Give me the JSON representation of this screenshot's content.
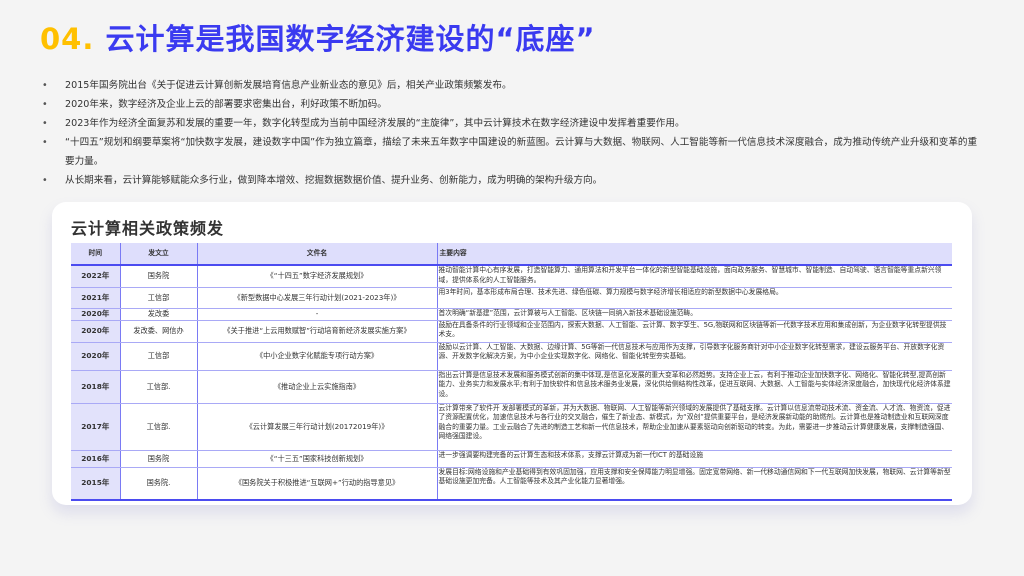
{
  "title": {
    "number": "04.",
    "text": "云计算是我国数字经济建设的“底座”"
  },
  "bullets": [
    "2015年国务院出台《关于促进云计算创新发展培育信息产业新业态的意见》后，相关产业政策频繁发布。",
    "2020年来，数字经济及企业上云的部署要求密集出台，利好政策不断加码。",
    "2023年作为经济全面复苏和发展的重要一年，数字化转型成为当前中国经济发展的“主旋律”，其中云计算技术在数字经济建设中发挥着重要作用。",
    "“十四五”规划和纲要草案将“加快数字发展，建设数字中国”作为独立篇章，描绘了未来五年数字中国建设的新蓝图。云计算与大数据、物联网、人工智能等新一代信息技术深度融合，成为推动传统产业升级和变革的重要力量。",
    "从长期来看，云计算能够赋能众多行业，做到降本增效、挖掘数据数据价值、提升业务、创新能力，成为明确的架构升级方向。"
  ],
  "table": {
    "title": "云计算相关政策频发",
    "headers": [
      "时间",
      "发文立",
      "文件名",
      "主要内容"
    ],
    "rows": [
      {
        "time": "2022年",
        "issuer": "国务院",
        "doc": "《“十四五”数字经济发展规划》",
        "content": "推动智能计算中心有序发展，打造智能算力、通用算法和开发平台一体化的新型智能基础设施，面向政务服务、智慧城市、智能制造、自动驾驶、语言智能等重点新兴领域，提供体系化的人工智能服务。"
      },
      {
        "time": "2021年",
        "issuer": "工信部",
        "doc": "《新型数据中心发展三年行动计划(2021-2023年)》",
        "content": "用3年时间，基本形成布局合理、技术先进、绿色低碳、算力规模与数字经济增长相适应的新型数据中心发展格局。"
      },
      {
        "time": "2020年",
        "issuer": "发改委",
        "doc": "-",
        "content": "首次明确“新基建”范围，云计算被与人工智能、区块链一同纳入新技术基础设施范畴。"
      },
      {
        "time": "2020年",
        "issuer": "发改委、网信办",
        "doc": "《关于推进“上云用数赋智”行动培育新经济发展实施方案》",
        "content": "鼓励在具备条件的行业领域和企业范围内，探索大数据、人工智能、云计算、数字孪生、5G,物联网和区块链等新一代数字技术应用和集成创新，为企业数字化转型提供技术支。"
      },
      {
        "time": "2020年",
        "issuer": "工信部",
        "doc": "《中小企业数字化赋能专项行动方案》",
        "content": "鼓励以云计算、人工智能、大数据、边缘计算、5G等新一代信息技术与应用作为支撑，引导数字化服务商针对中小企业数字化转型需求，建设云服务平台、开放数字化资源、开发数字化解决方案，为中小企业实现数字化、网络化、智能化转型夯实基础。"
      },
      {
        "time": "2018年",
        "issuer": "工信部.",
        "doc": "《推动企业上云实施指南》",
        "content": "指出云计算是信息技术发展和服务模式创新的集中体现,是信息化发展的重大变革和必然趋势。支持企业上云，有利于推动企业加快数字化、网络化、智能化转型,提高创新能力、业务实力和发展水平;有利于加快软件和信息技术服务业发展，深化供给侧结构性改革，促进互联网、大数据、人工智能与实体经济深度融合，加快现代化经济体系建设。"
      },
      {
        "time": "2017年",
        "issuer": "工信部.",
        "doc": "《云计算发展三年行动计划(20172019年)》",
        "content": "云计算带来了软件开 发部署模式的革新，并为大数据、物联网、人工智能等新兴领域的发展提供了基础支撑。云计算以信息流带动技术流、资金流、人才流、物资流，促进了资源配置优化，加速信息技术与各行业的交叉融合，催生了新业态、新模式，为“双创”提供重要平台，是经济发展新动能的助燃剂。云计算也是推动制造业和互联网深度融合的重要力量。工业云融合了先进的制造工艺和新一代信息技术，帮助企业加速从要素驱动向创新驱动的转变。为此，需要进一步推动云计算健康发展，支撑制造强国、网络强国建设。"
      },
      {
        "time": "2016年",
        "issuer": "国务院",
        "doc": "《“十三五”国家科技创新规划》",
        "content": "进一步强调要构建完备的云计算生态和技术体系，支撑云计算成为新一代ICT 的基础设施"
      },
      {
        "time": "2015年",
        "issuer": "国务院.",
        "doc": "《国务院关于积极推进“互联网+”行动的指导意见》",
        "content": "发展目标:网络设施和产业基础得到有效巩固加强，应用支撑和安全保障能力明显增强。固定宽带网络、新一代移动通信网和下一代互联网加快发展，物联网、云计算等新型基础设施更加完备。人工智能等技术及其产业化能力显著增强。"
      }
    ]
  },
  "colors": {
    "accent": "#3a3af0",
    "number": "#ffc000",
    "header_bg": "#dedefc"
  }
}
